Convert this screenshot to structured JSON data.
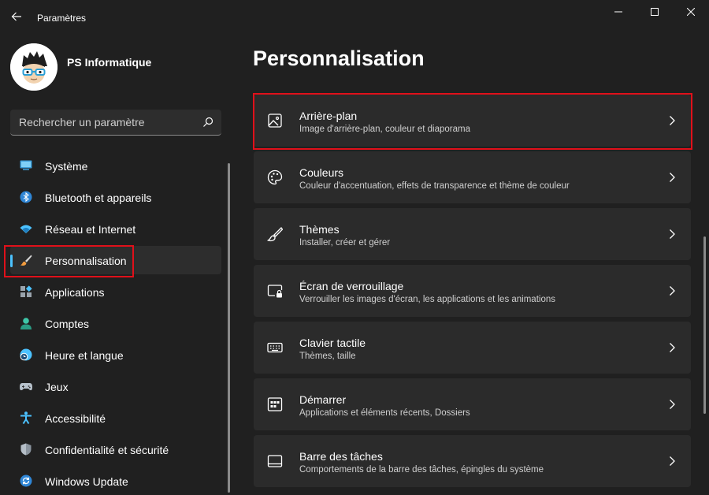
{
  "window": {
    "title": "Paramètres"
  },
  "user": {
    "name": "PS Informatique"
  },
  "search": {
    "placeholder": "Rechercher un paramètre"
  },
  "sidebar": {
    "items": [
      {
        "label": "Système",
        "icon": "monitor-icon"
      },
      {
        "label": "Bluetooth et appareils",
        "icon": "bluetooth-icon"
      },
      {
        "label": "Réseau et Internet",
        "icon": "wifi-icon"
      },
      {
        "label": "Personnalisation",
        "icon": "brush-icon",
        "active": true
      },
      {
        "label": "Applications",
        "icon": "apps-icon"
      },
      {
        "label": "Comptes",
        "icon": "account-icon"
      },
      {
        "label": "Heure et langue",
        "icon": "clock-globe-icon"
      },
      {
        "label": "Jeux",
        "icon": "gamepad-icon"
      },
      {
        "label": "Accessibilité",
        "icon": "accessibility-icon"
      },
      {
        "label": "Confidentialité et sécurité",
        "icon": "shield-icon"
      },
      {
        "label": "Windows Update",
        "icon": "update-icon"
      }
    ]
  },
  "main": {
    "title": "Personnalisation",
    "cards": [
      {
        "title": "Arrière-plan",
        "subtitle": "Image d'arrière-plan, couleur et diaporama",
        "icon": "image-icon"
      },
      {
        "title": "Couleurs",
        "subtitle": "Couleur d'accentuation, effets de transparence et thème de couleur",
        "icon": "palette-icon"
      },
      {
        "title": "Thèmes",
        "subtitle": "Installer, créer et gérer",
        "icon": "brush-outline-icon"
      },
      {
        "title": "Écran de verrouillage",
        "subtitle": "Verrouiller les images d'écran, les applications et les animations",
        "icon": "lock-screen-icon"
      },
      {
        "title": "Clavier tactile",
        "subtitle": "Thèmes, taille",
        "icon": "keyboard-icon"
      },
      {
        "title": "Démarrer",
        "subtitle": "Applications et éléments récents, Dossiers",
        "icon": "start-menu-icon"
      },
      {
        "title": "Barre des tâches",
        "subtitle": "Comportements de la barre des tâches, épingles du système",
        "icon": "taskbar-icon"
      }
    ]
  },
  "colors": {
    "accent": "#4cc2ff",
    "highlight": "#e0101a",
    "background": "#202020",
    "card": "#2b2b2b"
  }
}
